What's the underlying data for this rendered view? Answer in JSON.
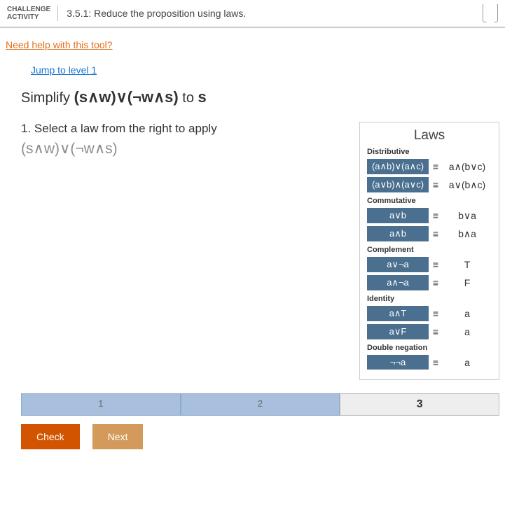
{
  "header": {
    "challenge_label_line1": "CHALLENGE",
    "challenge_label_line2": "ACTIVITY",
    "title": "3.5.1: Reduce the proposition using laws."
  },
  "help_link": "Need help with this tool?",
  "jump_link": "Jump to level 1",
  "simplify": {
    "prefix": "Simplify ",
    "expr": "(s∧w)∨(¬w∧s)",
    "mid": " to ",
    "target": "s"
  },
  "instruction": "1. Select a law from the right to apply",
  "current_expr": "(s∧w)∨(¬w∧s)",
  "laws_panel": {
    "title": "Laws",
    "groups": [
      {
        "name": "Distributive",
        "rows": [
          {
            "lhs": "(a∧b)∨(a∧c)",
            "rhs": "a∧(b∨c)"
          },
          {
            "lhs": "(a∨b)∧(a∨c)",
            "rhs": "a∨(b∧c)"
          }
        ]
      },
      {
        "name": "Commutative",
        "rows": [
          {
            "lhs": "a∨b",
            "rhs": "b∨a"
          },
          {
            "lhs": "a∧b",
            "rhs": "b∧a"
          }
        ]
      },
      {
        "name": "Complement",
        "rows": [
          {
            "lhs": "a∨¬a",
            "rhs": "T"
          },
          {
            "lhs": "a∧¬a",
            "rhs": "F"
          }
        ]
      },
      {
        "name": "Identity",
        "rows": [
          {
            "lhs": "a∧T",
            "rhs": "a"
          },
          {
            "lhs": "a∨F",
            "rhs": "a"
          }
        ]
      },
      {
        "name": "Double negation",
        "rows": [
          {
            "lhs": "¬¬a",
            "rhs": "a"
          }
        ]
      }
    ],
    "equiv": "≡"
  },
  "steps": [
    "1",
    "2",
    "3"
  ],
  "buttons": {
    "check": "Check",
    "next": "Next"
  },
  "progress": [
    {
      "state": "done",
      "num": "1"
    },
    {
      "state": "done",
      "num": "2"
    },
    {
      "state": "empty",
      "num": "3"
    }
  ],
  "check_glyph": "✓"
}
